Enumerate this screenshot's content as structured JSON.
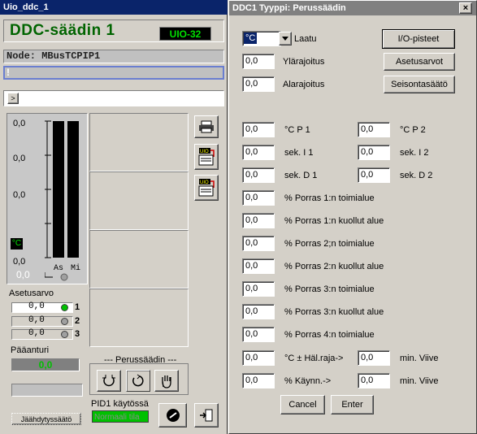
{
  "left": {
    "title": "Uio_ddc_1",
    "header_name": "DDC-säädin 1",
    "header_badge": "UIO-32",
    "node": "Node: MBusTCPIP1",
    "message": "!",
    "expand_label": ">",
    "gauge": {
      "labels": [
        "0,0",
        "0,0",
        "0,0",
        "0,0"
      ],
      "unit": "°C",
      "value": "0,0",
      "as_label": "As",
      "mi_label": "Mi"
    },
    "setpoint_label": "Asetusarvo",
    "setpoints": [
      {
        "value": "0,0",
        "num": "1",
        "led": "#00c000"
      },
      {
        "value": "0,0",
        "num": "2",
        "led": "#a0a0a0"
      },
      {
        "value": "0,0",
        "num": "3",
        "led": "#a0a0a0"
      }
    ],
    "main_sensor_label": "Pääanturi",
    "main_sensor_value": "0,0",
    "mode_title": "--- Perussäädin ---",
    "pid_label": "PID1 käytössä",
    "pid_value": "Normaali tila",
    "cooling_button": "Jäähdytyssäätö"
  },
  "dialog": {
    "title": "DDC1  Tyyppi: Perussäädin",
    "close": "×",
    "unit_select": "°C",
    "quality_label": "Laatu",
    "upper_limit_label": "Ylärajoitus",
    "lower_limit_label": "Alarajoitus",
    "upper_limit": "0,0",
    "lower_limit": "0,0",
    "io_button": "I/O-pisteet",
    "setpoints_button": "Asetusarvot",
    "standby_button": "Seisontasäätö",
    "params": [
      {
        "value": "0,0",
        "label": "°C  P 1",
        "value2": "0,0",
        "label2": "°C  P 2"
      },
      {
        "value": "0,0",
        "label": "sek. I 1",
        "value2": "0,0",
        "label2": "sek. I 2"
      },
      {
        "value": "0,0",
        "label": "sek. D 1",
        "value2": "0,0",
        "label2": "sek. D 2"
      },
      {
        "value": "0,0",
        "label": "%  Porras 1:n toimialue"
      },
      {
        "value": "0,0",
        "label": "%  Porras 1:n kuollut alue"
      },
      {
        "value": "0,0",
        "label": "%  Porras 2;n toimialue"
      },
      {
        "value": "0,0",
        "label": "%  Porras 2:n kuollut alue"
      },
      {
        "value": "0,0",
        "label": "%  Porras 3:n toimialue"
      },
      {
        "value": "0,0",
        "label": "%  Porras 3:n kuollut alue"
      },
      {
        "value": "0,0",
        "label": "%  Porras 4:n toimialue"
      },
      {
        "value": "0,0",
        "label": "°C ± Häl.raja->",
        "value2": "0,0",
        "label2": "min.  Viive"
      },
      {
        "value": "0,0",
        "label": "%  Käynn.->",
        "value2": "0,0",
        "label2": "min.  Viive"
      }
    ],
    "cancel_button": "Cancel",
    "enter_button": "Enter"
  }
}
